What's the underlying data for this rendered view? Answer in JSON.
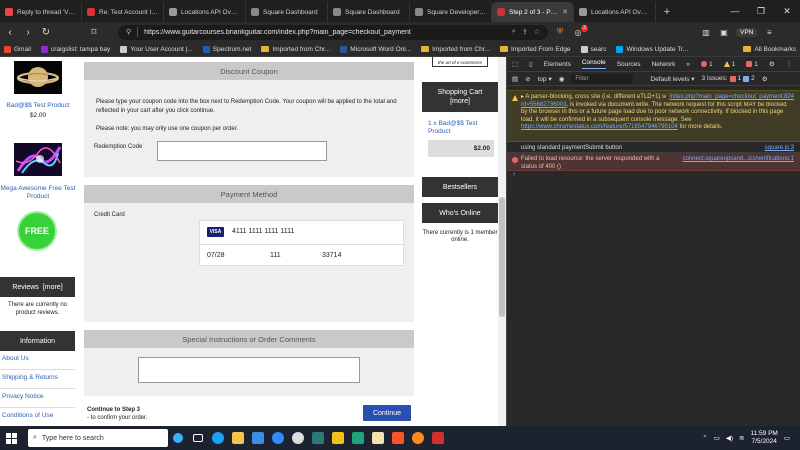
{
  "browser": {
    "tabs": [
      {
        "label": "Reply to thread 'VISA…",
        "color": "#e44"
      },
      {
        "label": "Re: Test Account Info",
        "color": "#d33"
      },
      {
        "label": "Locations API Overvi…",
        "color": "#999"
      },
      {
        "label": "Square Dashboard",
        "color": "#888"
      },
      {
        "label": "Square Dashboard",
        "color": "#888"
      },
      {
        "label": "Square Developer Da…",
        "color": "#888"
      },
      {
        "label": "Step 2 of 3 - Pa…",
        "color": "#c33"
      },
      {
        "label": "Locations API Overvi…",
        "color": "#999"
      }
    ],
    "url": "https://www.guitarcourses.briankguitar.com/index.php?main_page=checkout_payment",
    "vpn_label": "VPN",
    "notification_count": "3",
    "bookmarks": [
      {
        "label": "Gmail",
        "icon": "google-icon"
      },
      {
        "label": "craigslist: tampa bay",
        "icon": "peace-icon"
      },
      {
        "label": "Your User Account |...",
        "icon": "page-icon"
      },
      {
        "label": "Spectrum.net",
        "icon": "spectrum-icon"
      },
      {
        "label": "Imported from Chr...",
        "icon": "folder-icon"
      },
      {
        "label": "Microsoft Word Onl...",
        "icon": "word-icon"
      },
      {
        "label": "Imported from Chr...",
        "icon": "folder-icon"
      },
      {
        "label": "Imported From Edge",
        "icon": "folder-icon"
      },
      {
        "label": "searc",
        "icon": "page-icon"
      },
      {
        "label": "Windows Update Tr...",
        "icon": "windows-icon"
      }
    ],
    "all_bookmarks": "All Bookmarks"
  },
  "sidebar_left": {
    "product1": {
      "name": "Bad@$$ Test Product",
      "price": "$2.00"
    },
    "product2": {
      "name": "Mega Awesome Free Test Product",
      "badge": "FREE"
    },
    "reviews": {
      "title": "Reviews",
      "more": "[more]",
      "body": "There are currently no product reviews."
    },
    "information": {
      "title": "Information",
      "links": [
        "About Us",
        "Shipping & Returns",
        "Privacy Notice",
        "Conditions of Use"
      ]
    }
  },
  "checkout": {
    "coupon": {
      "title": "Discount Coupon",
      "intro": "Please type your coupon code into the box next to Redemption Code. Your coupon will be applied to the total and reflected in your cart after you click continue.",
      "note": "Please note: you may only use one coupon per order.",
      "label": "Redemption Code",
      "value": ""
    },
    "payment": {
      "title": "Payment Method",
      "method": "Credit Card",
      "brand": "VISA",
      "card_number": "4111 1111 1111 1111",
      "expiry": "07/28",
      "cvv": "111",
      "zip": "33714"
    },
    "instructions": {
      "title": "Special Instructions or Order Comments",
      "value": ""
    },
    "step_title": "Continue to Step 3",
    "step_sub": "- to confirm your order.",
    "continue_label": "Continue"
  },
  "sidebar_right": {
    "logo_text": "the art of e-commerce",
    "cart_title": "Shopping Cart",
    "cart_more": "[more]",
    "cart_item": "1 x  Bad@$$ Test Product",
    "cart_total": "$2.00",
    "bestsellers": "Bestsellers",
    "whos_online": "Who's Online",
    "online_text": "There currently is 1 member online."
  },
  "devtools": {
    "tabs": [
      "Elements",
      "Console",
      "Sources",
      "Network",
      "»"
    ],
    "active_tab": "Console",
    "badges": {
      "errors": "1",
      "warnings": "1",
      "issues": "1"
    },
    "context": "top",
    "filter_placeholder": "Filter",
    "levels": "Default levels ▾",
    "issues_label": "3 Issues:",
    "issues_err": "1",
    "issues_info": "2",
    "warning": {
      "text1": "A parser-blocking, cross site (i.e. different eTLD+1) script,",
      "link1": "https://pan.zen-cart.com/deailav/group/1?rd=55682736003",
      "text2": ", is invoked via document.write. The network request for this script MAY be blocked by the browser in this or a future page load due to poor network connectivity. If blocked in this page load, it will be confirmed in a subsequent console message. See",
      "link2": "https://www.chromestatus.com/feature/5718547946799104",
      "text3": "for more details.",
      "source": "index.php?main_page=checkout_payment:824"
    },
    "log": {
      "text": "using standard paymentSubmit button",
      "source": "square.js:3"
    },
    "error": {
      "text": "Failed to load resource: the server responded with a status of 400 ()",
      "source": "connect.squareupsand...ics/verifications:1"
    },
    "prompt": "›"
  },
  "taskbar": {
    "search_placeholder": "Type here to search",
    "time": "11:59 PM",
    "date": "7/5/2024"
  }
}
